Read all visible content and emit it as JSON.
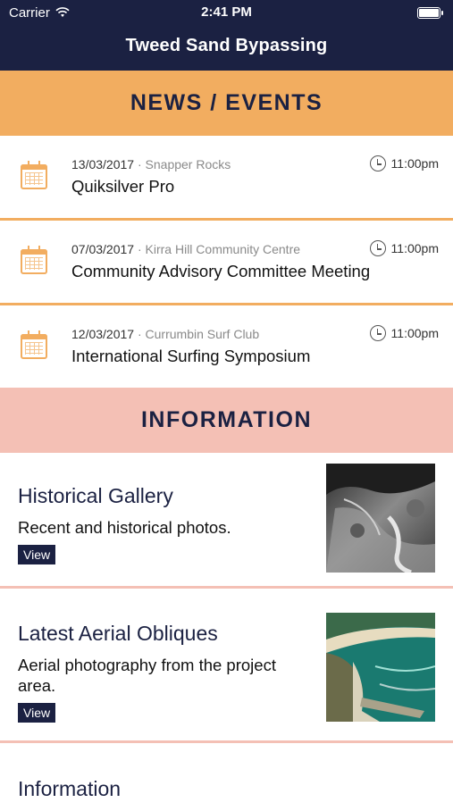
{
  "status": {
    "carrier": "Carrier",
    "time": "2:41 PM"
  },
  "nav": {
    "title": "Tweed Sand Bypassing"
  },
  "news": {
    "header": "NEWS / EVENTS",
    "items": [
      {
        "date": "13/03/2017",
        "location": "Snapper Rocks",
        "title": "Quiksilver Pro",
        "time": "11:00pm"
      },
      {
        "date": "07/03/2017",
        "location": "Kirra Hill Community Centre",
        "title": "Community Advisory Committee Meeting",
        "time": "11:00pm"
      },
      {
        "date": "12/03/2017",
        "location": "Currumbin Surf Club",
        "title": "International Surfing Symposium",
        "time": "11:00pm"
      }
    ]
  },
  "info": {
    "header": "INFORMATION",
    "items": [
      {
        "title": "Historical Gallery",
        "desc": "Recent and historical photos.",
        "button": "View"
      },
      {
        "title": "Latest Aerial Obliques",
        "desc": "Aerial photography from the project area.",
        "button": "View"
      },
      {
        "title": "Information"
      }
    ]
  },
  "separator": "·",
  "colors": {
    "navy": "#1b2142",
    "orange": "#f2ad60",
    "pink": "#f4c0b5"
  }
}
